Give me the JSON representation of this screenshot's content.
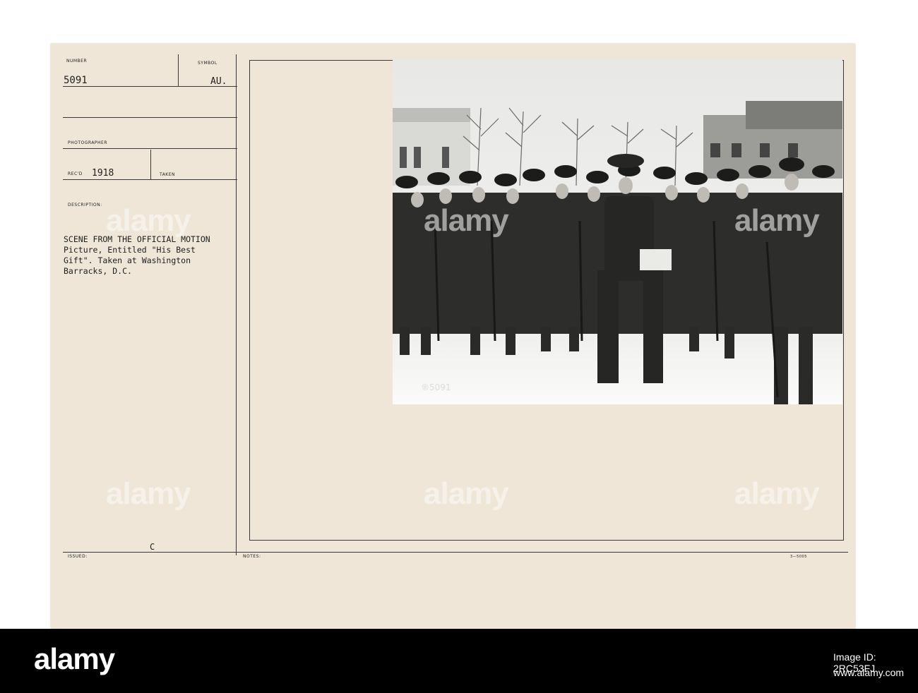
{
  "card": {
    "number_label": "NUMBER",
    "number_value": "5091",
    "symbol_label": "SYMBOL",
    "symbol_value": "AU.",
    "photographer_label": "PHOTOGRAPHER",
    "recd_label": "REC'D",
    "recd_value": "1918",
    "taken_label": "TAKEN",
    "description_label": "DESCRIPTION:",
    "description_lines": [
      "SCENE FROM THE OFFICIAL MOTION",
      "Picture, Entitled \"His Best",
      "Gift\". Taken at Washington",
      "Barracks, D.C."
    ],
    "issued_label": "ISSUED:",
    "issued_mark": "C",
    "notes_label": "NOTES:",
    "form_code": "3—5005",
    "photo_number": "®5091"
  },
  "watermark": "alamy",
  "stock": {
    "name": "alamy",
    "image_id_label": "Image ID: 2RC53FJ",
    "url": "www.alamy.com"
  },
  "colors": {
    "card": "#efe6d8",
    "ink": "#1e1e1e",
    "bar": "#000000"
  }
}
